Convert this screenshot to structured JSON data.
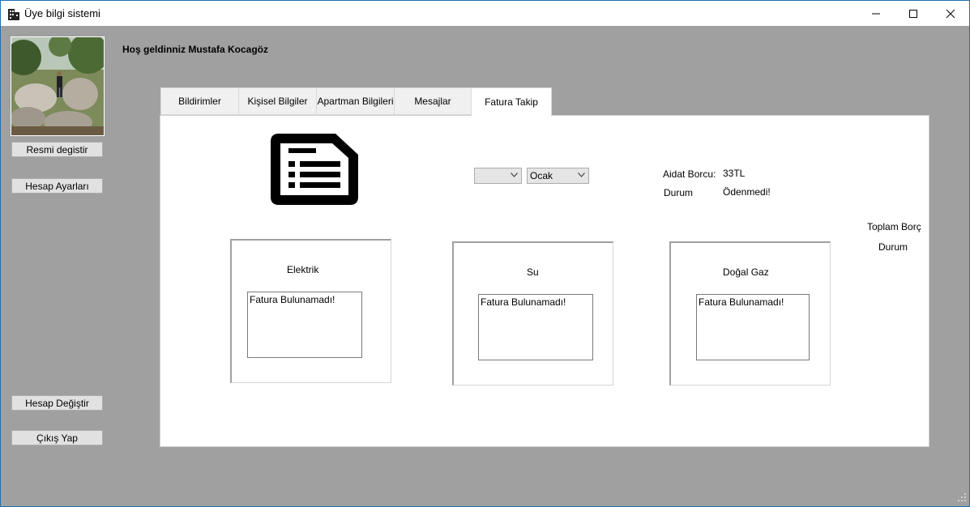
{
  "window": {
    "title": "Üye bilgi sistemi",
    "app_icon": "building-icon",
    "controls": [
      "minimize-icon",
      "maximize-icon",
      "close-icon"
    ]
  },
  "welcome_text": "Hoş geldinniz Mustafa Kocagöz",
  "sidebar": {
    "change_photo_label": "Resmi degistir",
    "account_settings_label": "Hesap Ayarları",
    "switch_account_label": "Hesap Değiştir",
    "logout_label": "Çıkış Yap"
  },
  "tabs": [
    {
      "label": "Bildirimler"
    },
    {
      "label": "Kişisel Bilgiler"
    },
    {
      "label": "Apartman Bilgileri"
    },
    {
      "label": "Mesajlar"
    },
    {
      "label": "Fatura Takip",
      "active": true
    }
  ],
  "fatura": {
    "document_icon": "invoice-document-icon",
    "year_select_value": "",
    "month_select_value": "Ocak",
    "aidat_label": "Aidat Borcu:",
    "aidat_value": "33TL",
    "durum_label": "Durum",
    "durum_value": "Ödenmedi!",
    "toplam_borc_label": "Toplam Borç",
    "toplam_durum_label": "Durum",
    "boxes": [
      {
        "title": "Elektrik",
        "content": "Fatura Bulunamadı!"
      },
      {
        "title": "Su",
        "content": "Fatura Bulunamadı!"
      },
      {
        "title": "Doğal Gaz",
        "content": "Fatura Bulunamadı!"
      }
    ]
  },
  "colors": {
    "window_border": "#1f6fb5",
    "client_background": "#a0a0a0",
    "button_face": "#e1e1e1"
  }
}
